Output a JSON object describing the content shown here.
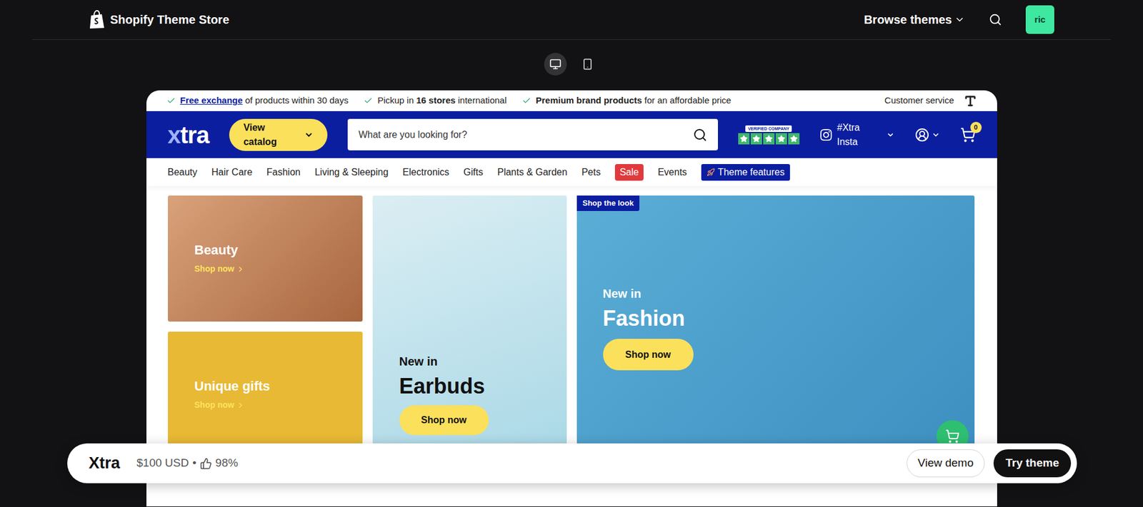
{
  "topbar": {
    "title": "Shopify Theme Store",
    "browse": "Browse themes",
    "avatar": "ric"
  },
  "device_toggle": [
    {
      "device": "desktop",
      "selected": true
    },
    {
      "device": "mobile",
      "selected": false
    }
  ],
  "preview": {
    "announcements": [
      [
        {
          "text": "Free exchange",
          "style": "link"
        },
        {
          "text": " of products within 30 days",
          "style": "plain"
        }
      ],
      [
        {
          "text": "Pickup in ",
          "style": "plain"
        },
        {
          "text": "16 stores",
          "style": "bold"
        },
        {
          "text": " international",
          "style": "plain"
        }
      ],
      [
        {
          "text": "Premium brand products",
          "style": "bold"
        },
        {
          "text": " for an affordable price",
          "style": "plain"
        }
      ]
    ],
    "customer_service": "Customer service",
    "header": {
      "logo": {
        "accent": "x",
        "rest": "tra"
      },
      "catalog_button": "View catalog",
      "search": {
        "placeholder": "What are you looking for?"
      },
      "badge": {
        "label": "VERIFIED COMPANY",
        "stars": 5
      },
      "instagram": "#Xtra Insta",
      "cart_count": "0"
    },
    "nav": [
      {
        "label": "Beauty",
        "kind": "plain"
      },
      {
        "label": "Hair Care",
        "kind": "plain"
      },
      {
        "label": "Fashion",
        "kind": "plain"
      },
      {
        "label": "Living & Sleeping",
        "kind": "plain"
      },
      {
        "label": "Electronics",
        "kind": "plain"
      },
      {
        "label": "Gifts",
        "kind": "plain"
      },
      {
        "label": "Plants & Garden",
        "kind": "plain"
      },
      {
        "label": "Pets",
        "kind": "plain"
      },
      {
        "label": "Sale",
        "kind": "sale"
      },
      {
        "label": "Events",
        "kind": "plain"
      },
      {
        "label": "Theme features",
        "kind": "feature"
      }
    ],
    "tiles": {
      "beauty": {
        "title": "Beauty",
        "link": "Shop now"
      },
      "gifts": {
        "title": "Unique gifts",
        "link": "Shop now"
      },
      "earbuds": {
        "eyebrow": "New in",
        "title": "Earbuds",
        "button": "Shop now"
      },
      "fashion": {
        "tag": "Shop the look",
        "eyebrow": "New in",
        "title": "Fashion",
        "button": "Shop now"
      }
    }
  },
  "bottom_bar": {
    "name": "Xtra",
    "price": "$100 USD",
    "separator": "•",
    "rating": "98%",
    "buttons": [
      "View demo",
      "Try theme"
    ]
  }
}
